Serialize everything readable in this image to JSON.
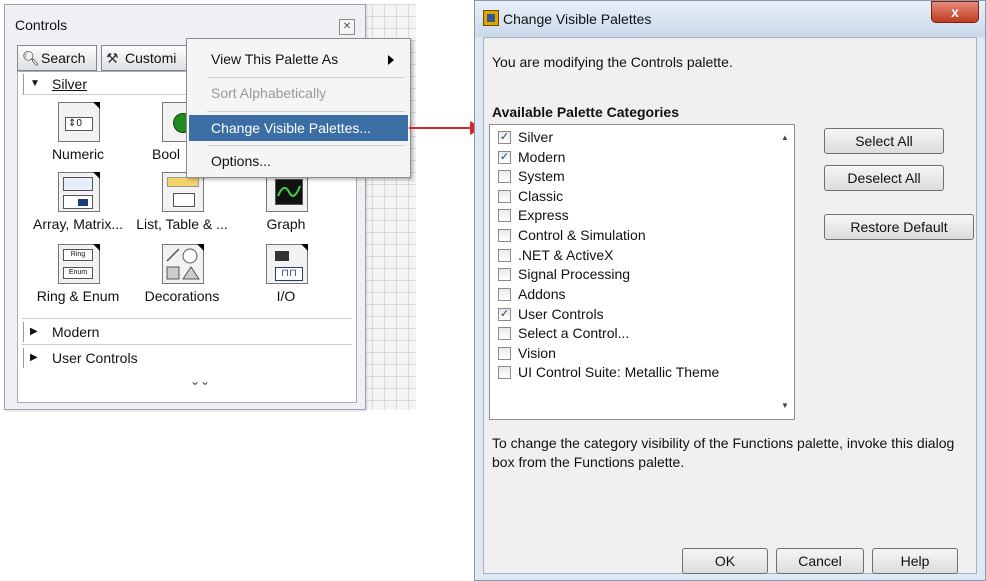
{
  "palette": {
    "title": "Controls",
    "close_icon": "x-icon",
    "search_label": "Search",
    "customize_label": "Customi",
    "categories": {
      "silver": "Silver",
      "modern": "Modern",
      "user_controls": "User Controls"
    },
    "items": [
      {
        "label": "Numeric"
      },
      {
        "label": "Bool"
      },
      {
        "label": "Array, Matrix..."
      },
      {
        "label": "List, Table & ..."
      },
      {
        "label": "Graph"
      },
      {
        "label": "Ring & Enum"
      },
      {
        "label": "Decorations"
      },
      {
        "label": "I/O"
      }
    ],
    "numeric_value": "0",
    "ring_text": "Ring",
    "enum_text": "Enum"
  },
  "context_menu": {
    "items": [
      {
        "label": "View This Palette As"
      },
      {
        "label": "Sort Alphabetically"
      },
      {
        "label": "Change Visible Palettes..."
      },
      {
        "label": "Options..."
      }
    ]
  },
  "dialog": {
    "title": "Change Visible Palettes",
    "close_label": "x",
    "description": "You are modifying the Controls palette.",
    "categories_label": "Available Palette Categories",
    "categories": [
      {
        "label": "Silver",
        "checked": true
      },
      {
        "label": "Modern",
        "checked": true
      },
      {
        "label": "System",
        "checked": false
      },
      {
        "label": "Classic",
        "checked": false
      },
      {
        "label": "Express",
        "checked": false
      },
      {
        "label": "Control & Simulation",
        "checked": false
      },
      {
        "label": ".NET & ActiveX",
        "checked": false
      },
      {
        "label": "Signal Processing",
        "checked": false
      },
      {
        "label": "Addons",
        "checked": false
      },
      {
        "label": "User Controls",
        "checked": true
      },
      {
        "label": "Select a Control...",
        "checked": false
      },
      {
        "label": "Vision",
        "checked": false
      },
      {
        "label": "UI Control Suite: Metallic Theme",
        "checked": false
      }
    ],
    "buttons": {
      "select_all": "Select All",
      "deselect_all": "Deselect All",
      "restore_default": "Restore Default",
      "ok": "OK",
      "cancel": "Cancel",
      "help": "Help"
    },
    "footer": "To change the category visibility of the Functions palette, invoke this dialog box from the Functions palette.",
    "check_mark": "✓"
  },
  "colors": {
    "menu_highlight": "#3a6ea5",
    "arrow": "#d9262b"
  }
}
